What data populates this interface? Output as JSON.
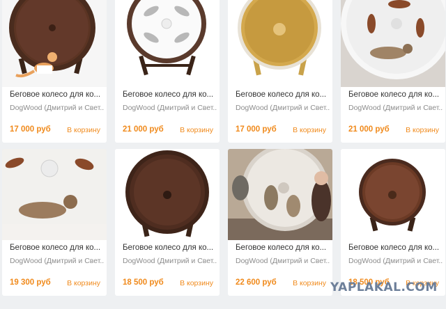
{
  "products": [
    {
      "title": "Беговое колесо для ко...",
      "seller": "DogWood (Дмитрий и Свет...",
      "price": "17 000 руб",
      "cart": "В корзину",
      "photo": "dark-wheel-ginger-cat"
    },
    {
      "title": "Беговое колесо для ко...",
      "seller": "DogWood (Дмитрий и Свет...",
      "price": "21 000 руб",
      "cart": "В корзину",
      "photo": "white-wheel-cat-silhouettes"
    },
    {
      "title": "Беговое колесо для ко...",
      "seller": "DogWood (Дмитрий и Свет...",
      "price": "17 000 руб",
      "cart": "В корзину",
      "photo": "light-wood-wheel"
    },
    {
      "title": "Беговое колесо для ко...",
      "seller": "DogWood (Дмитрий и Свет...",
      "price": "21 000 руб",
      "cart": "В корзину",
      "photo": "white-wheel-running-cat"
    },
    {
      "title": "Беговое колесо для ко...",
      "seller": "DogWood (Дмитрий и Свет...",
      "price": "19 300 руб",
      "cart": "В корзину",
      "photo": "white-wheel-closeup-cat"
    },
    {
      "title": "Беговое колесо для ко...",
      "seller": "DogWood (Дмитрий и Свет...",
      "price": "18 500 руб",
      "cart": "В корзину",
      "photo": "dark-wheel"
    },
    {
      "title": "Беговое колесо для ко...",
      "seller": "DogWood (Дмитрий и Свет...",
      "price": "22 600 руб",
      "cart": "В корзину",
      "photo": "wheel-room-woman-cats"
    },
    {
      "title": "Беговое колесо для ко...",
      "seller": "DogWood (Дмитрий и Свет...",
      "price": "18 500 руб",
      "cart": "В корзину",
      "photo": "dark-wheel-small"
    }
  ],
  "watermark": "YAPLAKAL.COM",
  "colors": {
    "accent": "#f08a1c",
    "background": "#eef0f2"
  }
}
